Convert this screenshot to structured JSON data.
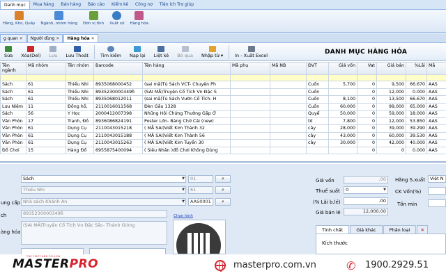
{
  "menu": [
    "Danh mục",
    "Mua hàng",
    "Bán hàng",
    "Báo cáo",
    "Kiểm kê",
    "Công nợ",
    "Tiện ích Trợ giúp"
  ],
  "ribbon": [
    "Hàng, Kho, Quầy",
    "Ngành, nhóm hàng",
    "Đơn vị tính",
    "Xuất xứ",
    "Hàng hóa"
  ],
  "tabs": [
    "g quan",
    "Người dùng",
    "Hàng hóa"
  ],
  "toolbar": {
    "sua": "Sửa",
    "xoa": "Xóa(Del)",
    "luu": "Lưu",
    "luuthoat": "Lưu Thoát",
    "timkiem": "Tìm kiếm",
    "napLai": "Nạp lại",
    "lietke": "Liệt kê",
    "boqua": "Bỏ qua",
    "nhaptu": "Nhập từ",
    "inxuat": "In - Xuất Excel"
  },
  "title": "DANH MỤC HÀNG HÓA",
  "columns": [
    "Tên ngành",
    "Mã nhóm",
    "Tên nhóm",
    "Barcode",
    "Tên hàng",
    "Mã phụ",
    "Mã NB",
    "ĐVT",
    "Giá vốn",
    "Vat",
    "Giá bán",
    "%Lãi",
    "Mã"
  ],
  "rows": [
    [
      "Sách",
      "61",
      "Thiếu Nhi",
      "8935068000452",
      "(sai mã)Tủ Sách VCT- Chuyện Ph",
      "",
      "",
      "Cuốn",
      "5,700",
      "0",
      "9,500",
      "66.670",
      "AAS"
    ],
    [
      "Sách",
      "61",
      "Thiếu Nhi",
      "8935230000349б",
      "(SAI MÃ)Truyện Cổ Tích Vn Đặc S",
      "",
      "",
      "Cuốn",
      "",
      "0",
      "12,000",
      "0.000",
      "AAS"
    ],
    [
      "Sách",
      "61",
      "Thiếu Nhi",
      "8935068012011",
      "(sai mã)Tủ Sách Vườn Cổ Tích- H",
      "",
      "",
      "Cuốn",
      "8,100",
      "0",
      "13,500",
      "66.670",
      "AAS"
    ],
    [
      "Lưu Niệm",
      "11",
      "Đồng hồ,",
      "2110016011568",
      "Đèn Gấu 1328",
      "",
      "",
      "Cuốn",
      "60,000",
      "0",
      "99,000",
      "65.000",
      "AAS"
    ],
    [
      "Sách",
      "56",
      "Y Học",
      "2000412007398",
      "Những Hội Chứng Thường Gặp Ở",
      "",
      "",
      "Quyể",
      "50,000",
      "0",
      "59,000",
      "18.000",
      "AAS"
    ],
    [
      "Văn Phòn",
      "17",
      "Tranh, Đồ",
      "8936086824191",
      "Poster Lớn- Bảng Chữ Cái (new)",
      "",
      "",
      "tờ",
      "7,800",
      "0",
      "12,000",
      "53.850",
      "AAS"
    ],
    [
      "Văn Phòn",
      "61",
      "Dụng Cụ",
      "2110043015218",
      "( MÃ SAI)Viết Kim Thành 32",
      "",
      "",
      "cây",
      "28,000",
      "0",
      "39,000",
      "39.290",
      "AAS"
    ],
    [
      "Văn Phòn",
      "61",
      "Dụng Cụ",
      "2110043015188",
      "( MÃ SAI)Viết Kim Thành 56",
      "",
      "",
      "cây",
      "43,000",
      "0",
      "60,000",
      "39.530",
      "AAS"
    ],
    [
      "Văn Phòn",
      "61",
      "Dụng Cụ",
      "2110043015263",
      "( MÃ SAI)Viết Kim Tuyền 30",
      "",
      "",
      "cây",
      "30,000",
      "0",
      "42,000",
      "40.000",
      "AAS"
    ],
    [
      "Đồ Chơi",
      "15",
      "Hàng Đồ",
      "6955875400094",
      "( Siêu Nhân )đồ Chơi Không Dùng",
      "",
      "",
      "",
      "",
      "0",
      "0",
      "0.000",
      "AAS"
    ]
  ],
  "form": {
    "nganh_val": "Sách",
    "nganh_code": "01",
    "nhom_val": "Thiếu Nhi",
    "nhom_code": "61",
    "ncc_label": "ung cấp",
    "ncc_val": "Nhà sách Khánh An",
    "ncc_code": "AAS0001",
    "ma_label": "ch",
    "barcode": "8935230000349б",
    "ten_label": "àng hóa",
    "tenhang": "(SAI MÃ)Truyện Cổ Tích Vn Đặc Sắc- Thánh Gióng",
    "chonhinh": "Chọn hình",
    "giavon_label": "Giá vốn",
    "giavon": ".00",
    "thue_label": "Thuế suất",
    "thue": "0",
    "lai_label": "(% Lãi b.lẻ)",
    "lai": ".00",
    "giabanle_label": "Giá bán lẻ",
    "giabanle": "12,000.00",
    "hangsx_label": "Hãng S.xuất",
    "hangsx": "Việt N",
    "ckvon_label": "CK Vốn(%)",
    "tonmin_label": "Tồn min",
    "tabs": [
      "Tính chất",
      "Giá khác",
      "Phân loại"
    ],
    "kichthuoc": "Kích thước"
  },
  "footer": {
    "slogan": "THE FIRST AND FOLLOW",
    "brand_a": "MASTER",
    "brand_b": "PRO",
    "web": "masterpro.com.vn",
    "phone": "1900.2929.51"
  }
}
